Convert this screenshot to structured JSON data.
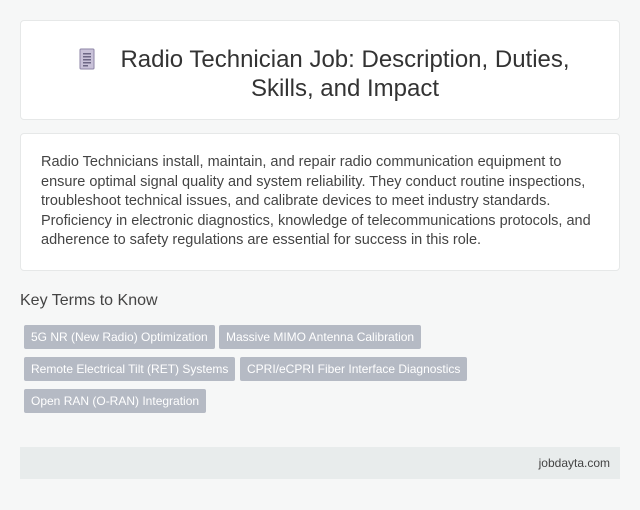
{
  "header": {
    "title": "Radio Technician Job: Description, Duties, Skills, and Impact",
    "icon": "document-icon"
  },
  "summary": {
    "text": "Radio Technicians install, maintain, and repair radio communication equipment to ensure optimal signal quality and system reliability. They conduct routine inspections, troubleshoot technical issues, and calibrate devices to meet industry standards. Proficiency in electronic diagnostics, knowledge of telecommunications protocols, and adherence to safety regulations are essential for success in this role."
  },
  "key_terms": {
    "heading": "Key Terms to Know",
    "items": [
      "5G NR (New Radio) Optimization",
      "Massive MIMO Antenna Calibration",
      "Remote Electrical Tilt (RET) Systems",
      "CPRI/eCPRI Fiber Interface Diagnostics",
      "Open RAN (O-RAN) Integration"
    ]
  },
  "footer": {
    "site": "jobdayta.com"
  },
  "colors": {
    "chip_bg": "#b5bac4",
    "footer_bg": "#e8ecec",
    "page_bg": "#f6f7f7"
  }
}
